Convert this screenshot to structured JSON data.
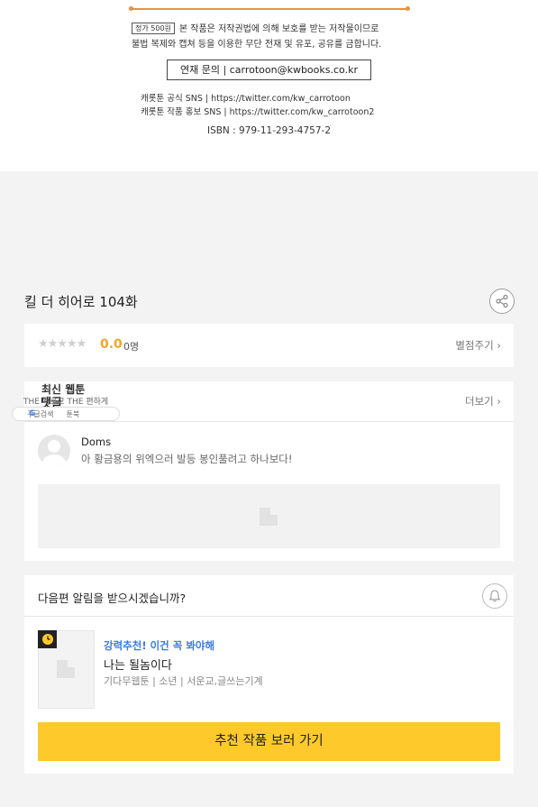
{
  "copyright": {
    "price_label": "정가 500원",
    "notice_line1": "본 작품은 저작권법에 의해 보호를 받는 저작물이므로",
    "notice_line2": "불법 복제와 캡쳐 등을 이용한 무단 전재 및 유포, 공유를 금합니다.",
    "contact": "연재 문의  |  carrotoon@kwbooks.co.kr",
    "sns_official": "캐롯툰 공식 SNS | https://twitter.com/kw_carrotoon",
    "sns_works": "캐롯툰 작품 홍보 SNS | https://twitter.com/kw_carrotoon2",
    "isbn": "ISBN : 979-11-293-4757-2"
  },
  "episode": {
    "title": "킬 더 히어로 104화"
  },
  "rating": {
    "stars": "★★★★★",
    "score": "0.0",
    "count": "0명",
    "rate_link": "별점주기 ›"
  },
  "comments": {
    "title": "댓글",
    "more_link": "더보기 ›",
    "items": [
      {
        "author": "Doms",
        "text": "아 황금용의 위엑으러 발등 봉인풀려고 하나보다!"
      }
    ]
  },
  "overlay": {
    "title": "최신 웹툰",
    "subtitle": "THE 빠르고 THE 편하게",
    "google_label": "구글검색",
    "toonbook_label": "툰북"
  },
  "next": {
    "question": "다음편 알림을 받으시겠습니까?",
    "recommendation": {
      "tag": "강력추천! 이건 꼭 봐야해",
      "title": "나는 될놈이다",
      "meta": "기다무웹툰 | 소년 | 서운교,글쓰는기계"
    },
    "button_label": "추천 작품 보러 가기"
  },
  "colors": {
    "accent_orange": "#e8913e",
    "score_orange": "#f5a623",
    "tag_blue": "#3a7be0",
    "button_yellow": "#fdc92b"
  }
}
